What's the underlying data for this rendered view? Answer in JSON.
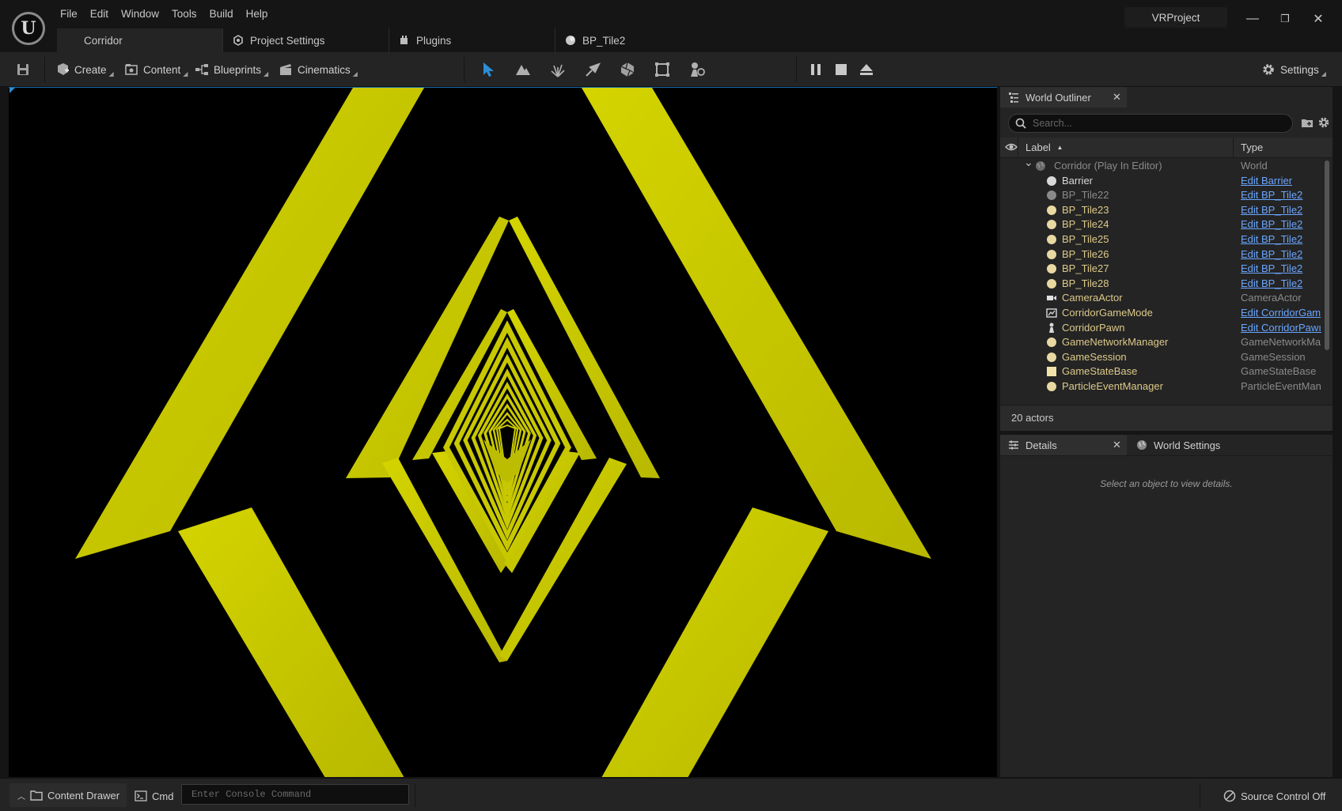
{
  "app": {
    "logo_letter": "U",
    "project_name": "VRProject"
  },
  "menu": [
    "File",
    "Edit",
    "Window",
    "Tools",
    "Build",
    "Help"
  ],
  "tabs": [
    {
      "label": "Corridor",
      "icon": "level-icon",
      "active": true
    },
    {
      "label": "Project Settings",
      "icon": "settings-icon",
      "active": false
    },
    {
      "label": "Plugins",
      "icon": "plugin-icon",
      "active": false
    },
    {
      "label": "BP_Tile2",
      "icon": "blueprint-icon",
      "active": false
    }
  ],
  "window_controls": {
    "minimize": "—",
    "restore": "❐",
    "close": "✕"
  },
  "toolbar": {
    "create_label": "Create",
    "content_label": "Content",
    "blueprints_label": "Blueprints",
    "cinematics_label": "Cinematics",
    "settings_label": "Settings",
    "modes": [
      "select-mode-icon",
      "landscape-mode-icon",
      "foliage-mode-icon",
      "mesh-paint-mode-icon",
      "fracture-mode-icon",
      "brush-edit-mode-icon",
      "animation-mode-icon"
    ],
    "play_controls": [
      "pause-icon",
      "stop-icon",
      "eject-icon"
    ]
  },
  "outliner": {
    "title": "World Outliner",
    "search_placeholder": "Search...",
    "col_label": "Label",
    "col_type": "Type",
    "sort_indicator": "▲",
    "rows": [
      {
        "label": "Corridor (Play In Editor)",
        "type": "World",
        "kind": "world",
        "link": false,
        "icon": "world-icon"
      },
      {
        "label": "Barrier",
        "type": "Edit Barrier",
        "kind": "normal",
        "link": true,
        "icon": "actor-icon"
      },
      {
        "label": "BP_Tile22",
        "type": "Edit BP_Tile2",
        "kind": "dim",
        "link": true,
        "icon": "actor-icon"
      },
      {
        "label": "BP_Tile23",
        "type": "Edit BP_Tile2",
        "kind": "normal",
        "link": true,
        "icon": "actor-icon"
      },
      {
        "label": "BP_Tile24",
        "type": "Edit BP_Tile2",
        "kind": "normal",
        "link": true,
        "icon": "actor-icon"
      },
      {
        "label": "BP_Tile25",
        "type": "Edit BP_Tile2",
        "kind": "normal",
        "link": true,
        "icon": "actor-icon"
      },
      {
        "label": "BP_Tile26",
        "type": "Edit BP_Tile2",
        "kind": "normal",
        "link": true,
        "icon": "actor-icon"
      },
      {
        "label": "BP_Tile27",
        "type": "Edit BP_Tile2",
        "kind": "normal",
        "link": true,
        "icon": "actor-icon"
      },
      {
        "label": "BP_Tile28",
        "type": "Edit BP_Tile2",
        "kind": "normal",
        "link": true,
        "icon": "actor-icon"
      },
      {
        "label": "CameraActor",
        "type": "CameraActor",
        "kind": "normal",
        "link": false,
        "icon": "camera-icon"
      },
      {
        "label": "CorridorGameMode",
        "type": "Edit CorridorGam",
        "kind": "normal",
        "link": true,
        "icon": "gamemode-icon"
      },
      {
        "label": "CorridorPawn",
        "type": "Edit CorridorPawı",
        "kind": "normal",
        "link": true,
        "icon": "pawn-icon"
      },
      {
        "label": "GameNetworkManager",
        "type": "GameNetworkMa",
        "kind": "normal",
        "link": false,
        "icon": "actor-icon"
      },
      {
        "label": "GameSession",
        "type": "GameSession",
        "kind": "normal",
        "link": false,
        "icon": "actor-icon"
      },
      {
        "label": "GameStateBase",
        "type": "GameStateBase",
        "kind": "normal",
        "link": false,
        "icon": "gamestate-icon"
      },
      {
        "label": "ParticleEventManager",
        "type": "ParticleEventMan",
        "kind": "normal",
        "link": false,
        "icon": "actor-icon"
      }
    ],
    "actor_count": "20 actors"
  },
  "details": {
    "title": "Details",
    "world_settings_label": "World Settings",
    "empty_text": "Select an object to view details."
  },
  "statusbar": {
    "content_drawer_label": "Content Drawer",
    "cmd_label": "Cmd",
    "console_placeholder": "Enter Console Command",
    "source_control_label": "Source Control Off"
  },
  "colors": {
    "viewport_bg": "#000000",
    "tunnel_yellow": "#cccc00",
    "accent_blue": "#2b8ed6",
    "link_blue": "#6aa6ff"
  }
}
